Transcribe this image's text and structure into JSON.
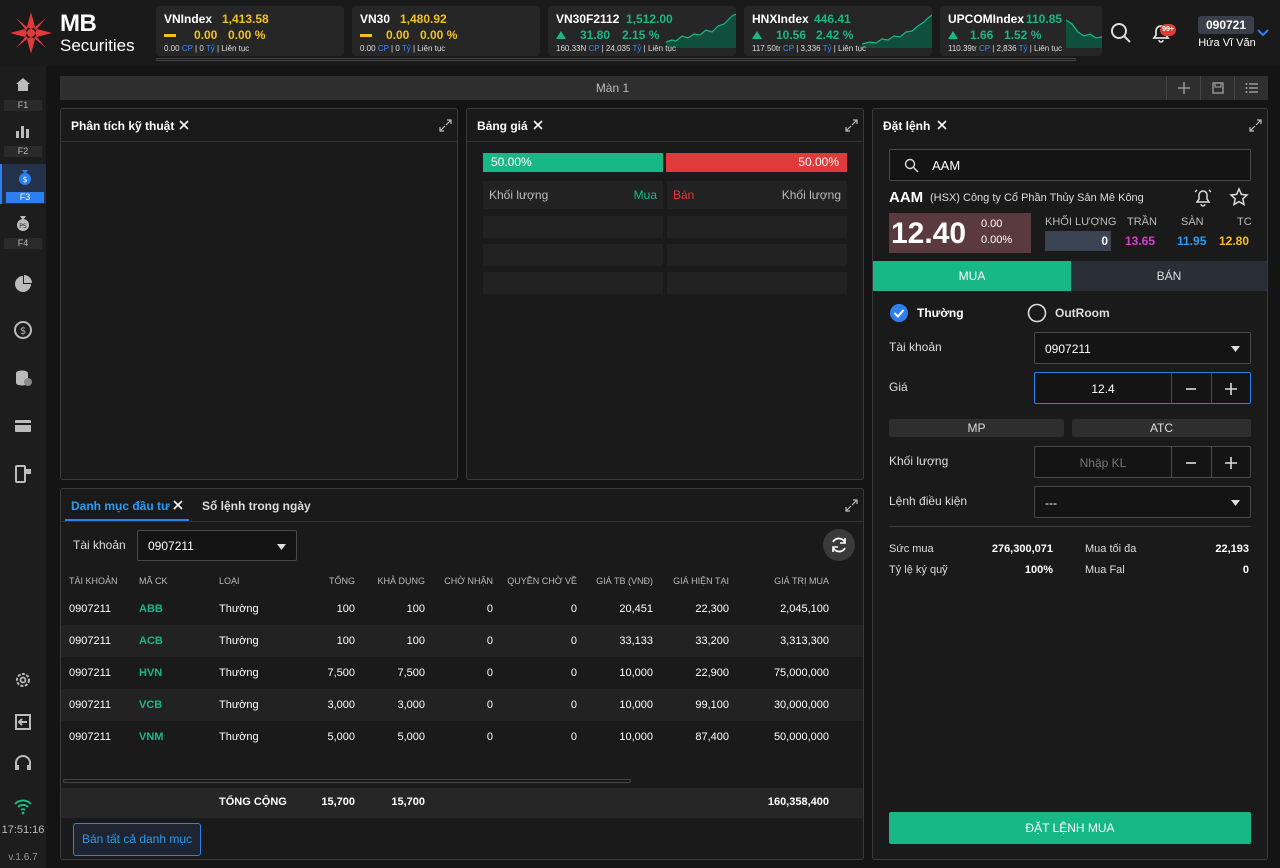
{
  "brand": {
    "line1": "MB",
    "line2": "Securities"
  },
  "tickers": [
    {
      "name": "VNIndex",
      "value": "1,413.58",
      "change": "0.00",
      "pct": "0.00 %",
      "dir": "flat",
      "volume": "0.00",
      "vol_unit": "CP",
      "value_amt": "0",
      "val_unit": "Tỷ",
      "session": "Liên tục"
    },
    {
      "name": "VN30",
      "value": "1,480.92",
      "change": "0.00",
      "pct": "0.00 %",
      "dir": "flat",
      "volume": "0.00",
      "vol_unit": "CP",
      "value_amt": "0",
      "val_unit": "Tỷ",
      "session": "Liên tục"
    },
    {
      "name": "VN30F2112",
      "value": "1,512.00",
      "change": "31.80",
      "pct": "2.15 %",
      "dir": "up",
      "volume": "160.33N",
      "vol_unit": "CP",
      "value_amt": "24,035",
      "val_unit": "Tỷ",
      "session": "Liên tục"
    },
    {
      "name": "HNXIndex",
      "value": "446.41",
      "change": "10.56",
      "pct": "2.42 %",
      "dir": "up",
      "volume": "117.50tr",
      "vol_unit": "CP",
      "value_amt": "3,336",
      "val_unit": "Tỷ",
      "session": "Liên tục"
    },
    {
      "name": "UPCOMIndex",
      "value": "110.85",
      "change": "1.66",
      "pct": "1.52 %",
      "dir": "up",
      "volume": "110.39tr",
      "vol_unit": "CP",
      "value_amt": "2,836",
      "val_unit": "Tỷ",
      "session": "Liên tục"
    }
  ],
  "header": {
    "notif_badge": "99+",
    "account_id": "090721",
    "user_name": "Hứa Vĩ Văn"
  },
  "sidebar": {
    "items": [
      {
        "key": "F1"
      },
      {
        "key": "F2"
      },
      {
        "key": "F3"
      },
      {
        "key": "F4"
      }
    ],
    "clock": "17:51:16",
    "version": "v.1.6.7"
  },
  "screen": {
    "title": "Màn 1"
  },
  "ta_panel": {
    "title": "Phân tích kỹ thuật"
  },
  "price_board": {
    "title": "Bảng giá",
    "buy_pct": "50.00%",
    "sell_pct": "50.00%",
    "col_vol_left": "Khối lượng",
    "col_buy": "Mua",
    "col_sell": "Bán",
    "col_vol_right": "Khối lượng"
  },
  "order": {
    "title": "Đặt lệnh",
    "search_value": "AAM",
    "symbol": "AAM",
    "exchange_name": "(HSX) Công ty Cổ Phần Thủy Sản Mê Kông",
    "price": "12.40",
    "change": "0.00",
    "change_pct": "0.00%",
    "vol_label": "KHỐI LƯỢNG",
    "vol_value": "0",
    "ceil_label": "TRẦN",
    "ceil_value": "13.65",
    "floor_label": "SÀN",
    "floor_value": "11.95",
    "ref_label": "TC",
    "ref_value": "12.80",
    "tab_buy": "MUA",
    "tab_sell": "BÁN",
    "opt_normal": "Thường",
    "opt_outroom": "OutRoom",
    "account_label": "Tài khoản",
    "account_value": "0907211",
    "price_label": "Giá",
    "price_value": "12.4",
    "chip_mp": "MP",
    "chip_atc": "ATC",
    "qty_label": "Khối lượng",
    "qty_placeholder": "Nhập KL",
    "cond_label": "Lệnh điều kiện",
    "cond_value": "---",
    "buying_power_label": "Sức mua",
    "buying_power_value": "276,300,071",
    "max_buy_label": "Mua tối đa",
    "max_buy_value": "22,193",
    "margin_label": "Tỷ lệ ký quỹ",
    "margin_value": "100%",
    "buy_fal_label": "Mua Fal",
    "buy_fal_value": "0",
    "submit": "ĐẶT LỆNH MUA"
  },
  "portfolio": {
    "tab_active": "Danh mục đầu tư",
    "tab_other": "Sổ lệnh trong ngày",
    "account_label": "Tài khoản",
    "account_value": "0907211",
    "columns": [
      "TÀI KHOẢN",
      "MÃ CK",
      "LOẠI",
      "TỔNG",
      "KHẢ DỤNG",
      "CHỜ NHẬN",
      "QUYỀN CHỜ VỀ",
      "GIÁ TB (VNĐ)",
      "GIÁ HIỆN TẠI",
      "GIÁ TRỊ MUA"
    ],
    "rows": [
      [
        "0907211",
        "ABB",
        "Thường",
        "100",
        "100",
        "0",
        "0",
        "20,451",
        "22,300",
        "2,045,100"
      ],
      [
        "0907211",
        "ACB",
        "Thường",
        "100",
        "100",
        "0",
        "0",
        "33,133",
        "33,200",
        "3,313,300"
      ],
      [
        "0907211",
        "HVN",
        "Thường",
        "7,500",
        "7,500",
        "0",
        "0",
        "10,000",
        "22,900",
        "75,000,000"
      ],
      [
        "0907211",
        "VCB",
        "Thường",
        "3,000",
        "3,000",
        "0",
        "0",
        "10,000",
        "99,100",
        "30,000,000"
      ],
      [
        "0907211",
        "VNM",
        "Thường",
        "5,000",
        "5,000",
        "0",
        "0",
        "10,000",
        "87,400",
        "50,000,000"
      ]
    ],
    "total_label": "TỔNG CỘNG",
    "total_qty": "15,700",
    "total_avail": "15,700",
    "total_value": "160,358,400",
    "sell_all": "Bán tất cả danh mục"
  }
}
